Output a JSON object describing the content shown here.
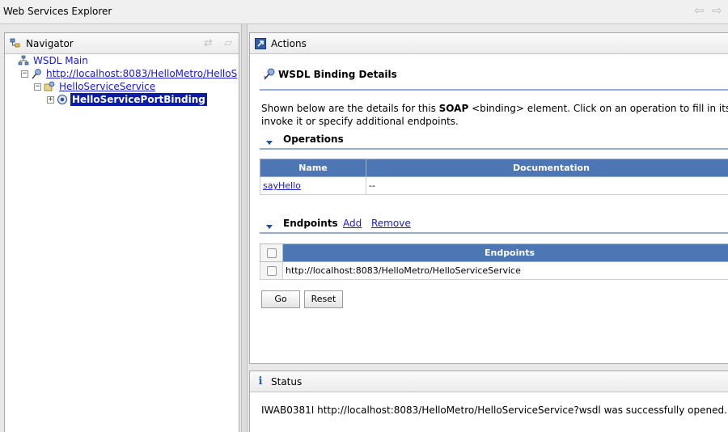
{
  "window": {
    "title": "Web Services Explorer",
    "back_icon": "back-arrow-icon",
    "forward_icon": "forward-arrow-icon"
  },
  "navigator": {
    "header": "Navigator",
    "tree": {
      "root": "WSDL Main",
      "wsdl_url": "http://localhost:8083/HelloMetro/HelloS",
      "service": "HelloServiceService",
      "binding": "HelloServicePortBinding"
    }
  },
  "actions": {
    "header": "Actions",
    "title": "WSDL Binding Details",
    "description_pre": "Shown below are the details for this ",
    "description_bold": "SOAP",
    "description_post": " <binding> element. Click on an operation to fill in its pa",
    "description_line2": "invoke it or specify additional endpoints.",
    "operations": {
      "heading": "Operations",
      "columns": [
        "Name",
        "Documentation"
      ],
      "rows": [
        {
          "name": "sayHello",
          "documentation": "--"
        }
      ]
    },
    "endpoints": {
      "heading": "Endpoints",
      "add_label": "Add",
      "remove_label": "Remove",
      "column": "Endpoints",
      "rows": [
        {
          "url": "http://localhost:8083/HelloMetro/HelloServiceService"
        }
      ]
    },
    "go_label": "Go",
    "reset_label": "Reset"
  },
  "status": {
    "header": "Status",
    "message": "IWAB0381I http://localhost:8083/HelloMetro/HelloServiceService?wsdl was successfully opened."
  },
  "colors": {
    "table_header": "#4d76b5",
    "selection": "#0a1ca8",
    "link": "#1a1ad6",
    "rule": "#97a9d6"
  }
}
